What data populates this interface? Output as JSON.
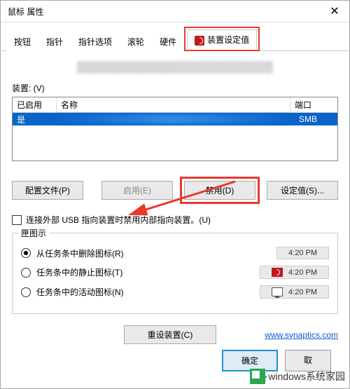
{
  "window": {
    "title": "鼠标 属性"
  },
  "tabs": {
    "items": [
      "按钮",
      "指针",
      "指针选项",
      "滚轮",
      "硬件",
      "装置设定值"
    ],
    "active_index": 5
  },
  "device": {
    "label": "装置: (V)",
    "columns": {
      "enabled": "已启用",
      "name": "名称",
      "port": "端口"
    },
    "row": {
      "enabled": "是",
      "port": "SMB"
    }
  },
  "buttons": {
    "profile": "配置文件(P)",
    "enable": "启用(E)",
    "disable": "禁用(D)",
    "settings": "设定值(S)...",
    "reset": "重设装置(C)",
    "ok": "确定",
    "cancel": "取"
  },
  "checkbox": {
    "label": "连接外部 USB 指向装置时禁用内部指向装置。(U)"
  },
  "tray": {
    "group": "匣图示",
    "opt_remove": "从任务条中删除图标(R)",
    "opt_static": "任务条中的静止图标(T)",
    "opt_active": "任务条中的活动图标(N)",
    "time": "4:20 PM"
  },
  "link": {
    "text": "www.synaptics.com"
  },
  "watermark": {
    "text": "windows系统家园"
  }
}
